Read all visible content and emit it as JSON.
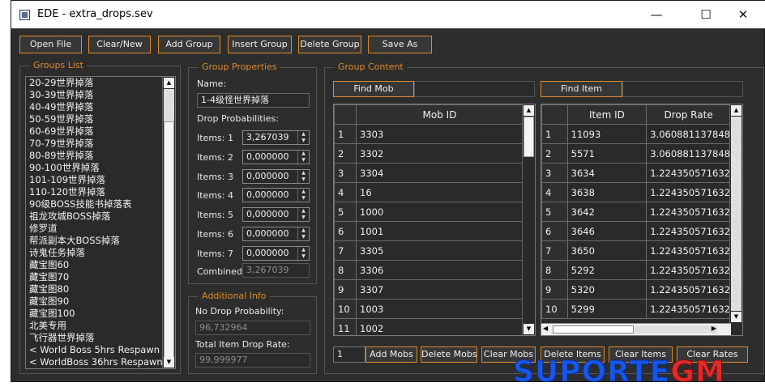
{
  "window": {
    "title": "EDE - extra_drops.sev",
    "minimize": "—",
    "maximize": "☐",
    "close": "✕"
  },
  "toolbar": {
    "open_file": "Open File",
    "clear_new": "Clear/New",
    "add_group": "Add Group",
    "insert_group": "Insert Group",
    "delete_group": "Delete Group",
    "save_as": "Save As"
  },
  "groups_list": {
    "legend": "Groups List",
    "items": [
      "20-29世界掉落",
      "30-39世界掉落",
      "40-49世界掉落",
      "50-59世界掉落",
      "60-69世界掉落",
      "70-79世界掉落",
      "80-89世界掉落",
      "90-100世界掉落",
      "101-109世界掉落",
      "110-120世界掉落",
      "90级BOSS技能书掉落表",
      "祖龙攻城BOSS掉落",
      "修罗道",
      "帮派副本大BOSS掉落",
      "诗鬼任务掉落",
      "藏宝图60",
      "藏宝图70",
      "藏宝图80",
      "藏宝图90",
      "藏宝图100",
      "北美专用",
      "飞行器世界掉落",
      "< World Boss 5hrs Respawn >",
      "< WorldBoss 36hrs Respawn >"
    ]
  },
  "group_properties": {
    "legend": "Group Properties",
    "name_label": "Name:",
    "name_value": "1-4级怪世界掉落",
    "drop_prob_label": "Drop Probabilities:",
    "items": [
      {
        "label": "Items: 1",
        "value": "3,267039"
      },
      {
        "label": "Items: 2",
        "value": "0,000000"
      },
      {
        "label": "Items: 3",
        "value": "0,000000"
      },
      {
        "label": "Items: 4",
        "value": "0,000000"
      },
      {
        "label": "Items: 5",
        "value": "0,000000"
      },
      {
        "label": "Items: 6",
        "value": "0,000000"
      },
      {
        "label": "Items: 7",
        "value": "0,000000"
      }
    ],
    "combined_label": "Combined:",
    "combined_value": "3,267039"
  },
  "additional_info": {
    "legend": "Additional Info",
    "no_drop_label": "No Drop Probability:",
    "no_drop_value": "96,732964",
    "total_rate_label": "Total Item Drop Rate:",
    "total_rate_value": "99,999977"
  },
  "group_content": {
    "legend": "Group Content",
    "find_mob": "Find Mob",
    "find_item": "Find Item",
    "mob_table": {
      "header": "Mob ID",
      "rows": [
        [
          "1",
          "3303"
        ],
        [
          "2",
          "3302"
        ],
        [
          "3",
          "3304"
        ],
        [
          "4",
          "16"
        ],
        [
          "5",
          "1000"
        ],
        [
          "6",
          "1001"
        ],
        [
          "7",
          "3305"
        ],
        [
          "8",
          "3306"
        ],
        [
          "9",
          "3307"
        ],
        [
          "10",
          "1003"
        ],
        [
          "11",
          "1002"
        ]
      ]
    },
    "item_table": {
      "headers": [
        "Item ID",
        "Drop Rate"
      ],
      "rows": [
        [
          "1",
          "11093",
          "3.060881137848"
        ],
        [
          "2",
          "5571",
          "3.060881137848"
        ],
        [
          "3",
          "3634",
          "1.224350571632"
        ],
        [
          "4",
          "3638",
          "1.224350571632"
        ],
        [
          "5",
          "3642",
          "1.224350571632"
        ],
        [
          "6",
          "3646",
          "1.224350571632"
        ],
        [
          "7",
          "3650",
          "1.224350571632"
        ],
        [
          "8",
          "5292",
          "1.224350571632"
        ],
        [
          "9",
          "5320",
          "1.224350571632"
        ],
        [
          "10",
          "5299",
          "1.224350571632"
        ]
      ]
    },
    "mob_count": "1",
    "add_mobs": "Add Mobs",
    "delete_mobs": "Delete Mobs",
    "clear_mobs": "Clear Mobs",
    "delete_items": "Delete Items",
    "clear_items": "Clear Items",
    "clear_rates": "Clear Rates"
  },
  "watermark": {
    "main": "SUPORTE",
    "accent": "GM"
  }
}
